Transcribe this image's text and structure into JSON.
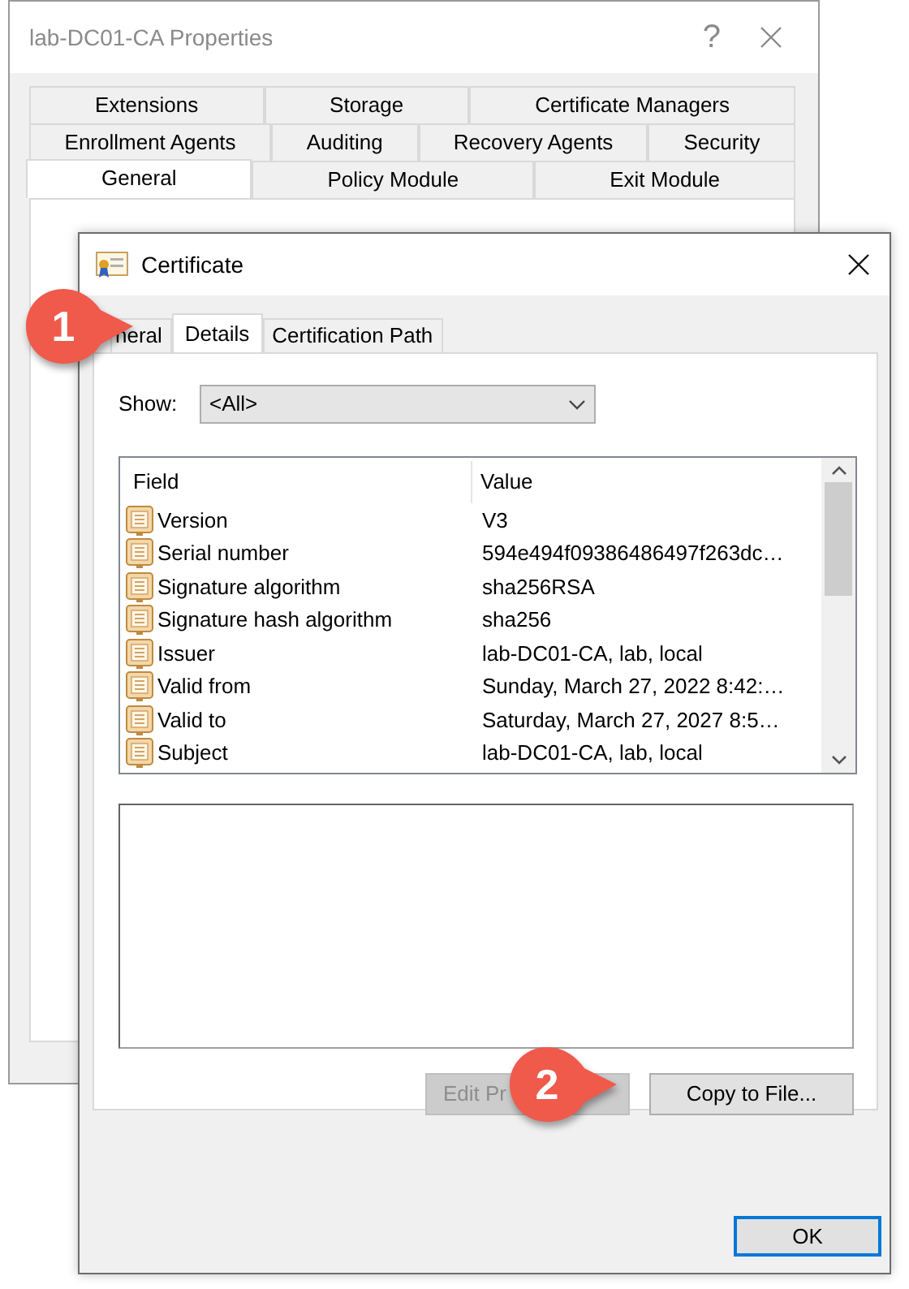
{
  "background_window": {
    "title": "lab-DC01-CA Properties",
    "help": "?",
    "tab_rows": [
      [
        {
          "label": "Extensions",
          "selected": false
        },
        {
          "label": "Storage",
          "selected": false
        },
        {
          "label": "Certificate Managers",
          "selected": false
        }
      ],
      [
        {
          "label": "Enrollment Agents",
          "selected": false
        },
        {
          "label": "Auditing",
          "selected": false
        },
        {
          "label": "Recovery Agents",
          "selected": false
        },
        {
          "label": "Security",
          "selected": false
        }
      ],
      [
        {
          "label": "General",
          "selected": true
        },
        {
          "label": "Policy Module",
          "selected": false
        },
        {
          "label": "Exit Module",
          "selected": false
        }
      ]
    ]
  },
  "certificate_dialog": {
    "title": "Certificate",
    "tabs": [
      {
        "label": "neral",
        "selected": false
      },
      {
        "label": "Details",
        "selected": true
      },
      {
        "label": "Certification Path",
        "selected": false
      }
    ],
    "show_label": "Show:",
    "show_value": "<All>",
    "list": {
      "columns": [
        "Field",
        "Value"
      ],
      "rows": [
        {
          "field": "Version",
          "value": "V3"
        },
        {
          "field": "Serial number",
          "value": "594e494f09386486497f263dc…"
        },
        {
          "field": "Signature algorithm",
          "value": "sha256RSA"
        },
        {
          "field": "Signature hash algorithm",
          "value": "sha256"
        },
        {
          "field": "Issuer",
          "value": "lab-DC01-CA, lab, local"
        },
        {
          "field": "Valid from",
          "value": "Sunday, March 27, 2022 8:42:…"
        },
        {
          "field": "Valid to",
          "value": "Saturday, March 27, 2027 8:5…"
        },
        {
          "field": "Subject",
          "value": "lab-DC01-CA, lab, local"
        }
      ]
    },
    "buttons": [
      {
        "label": "Edit Pr",
        "disabled": true
      },
      {
        "label": "Copy to File...",
        "disabled": false
      }
    ],
    "ok": "OK"
  },
  "callouts": [
    {
      "number": "1"
    },
    {
      "number": "2"
    }
  ]
}
